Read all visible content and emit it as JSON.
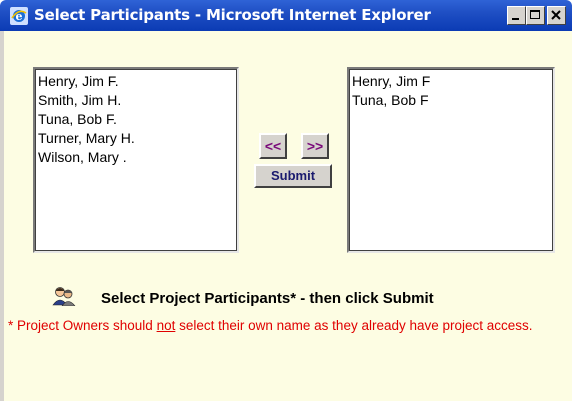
{
  "window": {
    "title": "Select Participants - Microsoft Internet Explorer",
    "controls": {
      "minimize": "minimize",
      "maximize": "maximize",
      "close": "close"
    }
  },
  "available_list": {
    "items": [
      "Henry, Jim F.",
      "Smith, Jim H.",
      "Tuna, Bob F.",
      "Turner, Mary H.",
      "Wilson, Mary ."
    ]
  },
  "selected_list": {
    "items": [
      "Henry, Jim F",
      "Tuna, Bob F"
    ]
  },
  "buttons": {
    "remove_label": "<<",
    "add_label": ">>",
    "submit_label": "Submit"
  },
  "instructions": {
    "heading": "Select Project Participants* - then click Submit",
    "note_part1": "* Project Owners should ",
    "note_emphasis": "not",
    "note_part2": " select their own name as they already have project access."
  },
  "colors": {
    "titlebar": "#0b3bb4",
    "background": "#fdfde3",
    "note_text": "#e00000",
    "arrow_text": "#7a0a7a"
  },
  "icons": [
    "ie-icon",
    "people-icon",
    "minimize-icon",
    "maximize-icon",
    "close-icon"
  ]
}
